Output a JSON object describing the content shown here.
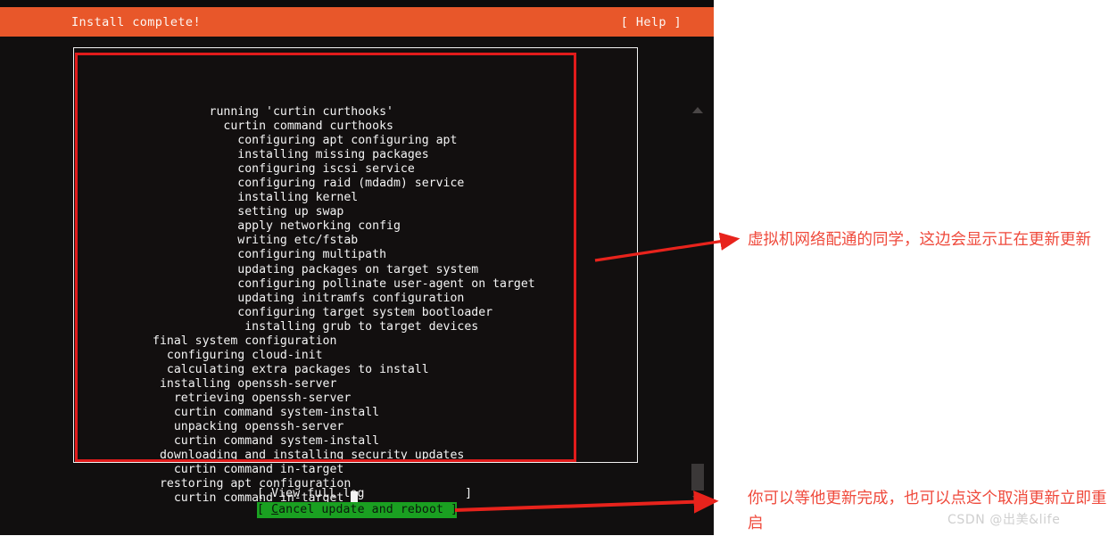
{
  "installer": {
    "header": {
      "title": "Install complete!",
      "help_label": "[ Help ]",
      "background_color": "#e8572a"
    },
    "log_lines": [
      "        running 'curtin curthooks'",
      "          curtin command curthooks",
      "            configuring apt configuring apt",
      "            installing missing packages",
      "            configuring iscsi service",
      "            configuring raid (mdadm) service",
      "            installing kernel",
      "            setting up swap",
      "            apply networking config",
      "            writing etc/fstab",
      "            configuring multipath",
      "            updating packages on target system",
      "            configuring pollinate user-agent on target",
      "            updating initramfs configuration",
      "            configuring target system bootloader",
      "             installing grub to target devices",
      "final system configuration",
      "  configuring cloud-init",
      "  calculating extra packages to install",
      " installing openssh-server",
      "   retrieving openssh-server",
      "   curtin command system-install",
      "   unpacking openssh-server",
      "   curtin command system-install",
      " downloading and installing security updates",
      "   curtin command in-target",
      " restoring apt configuration",
      "   curtin command in-target "
    ],
    "cursor": " ",
    "buttons": {
      "view_full_log": "[ View full log              ]",
      "cancel_prefix": "[ ",
      "cancel_accel": "C",
      "cancel_rest": "ancel update and reboot ]",
      "selected": "cancel-update-and-reboot",
      "selected_background": "#1aa021"
    },
    "scrollbar": {
      "up_arrow": "scroll-up-arrow",
      "down_arrow": "scroll-down-arrow",
      "thumb": "scroll-thumb"
    }
  },
  "annotations": {
    "color": "#ef4a3c",
    "note_top": "虚拟机网络配通的同学，这边会显示正在更新更新",
    "note_bottom": "你可以等他更新完成，也可以点这个取消更新立即重启"
  },
  "watermark": "CSDN @出美&life"
}
